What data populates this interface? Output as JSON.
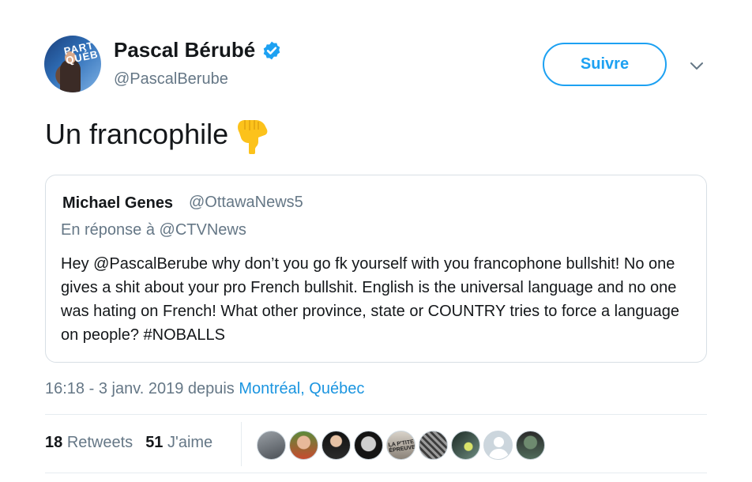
{
  "author": {
    "name": "Pascal Bérubé",
    "handle": "@PascalBerube",
    "avatar_text": "PART\nQUÉB",
    "verified_icon": "verified-badge-icon"
  },
  "follow_label": "Suivre",
  "tweet_text": "Un francophile",
  "emoji": "backhand-index-pointing-down",
  "quoted": {
    "name": "Michael Genes",
    "handle": "@OttawaNews5",
    "reply_to": "En réponse à @CTVNews",
    "body": "Hey @PascalBerube why don’t you go fk yourself with you francophone bullshit! No one gives a shit about your pro French bullshit. English is the universal language and no one was hating on French! What other province, state or COUNTRY tries to force a language on people? #NOBALLS"
  },
  "meta": {
    "time": "16:18 - 3 janv. 2019 depuis ",
    "location": "Montréal, Québec"
  },
  "stats": {
    "retweets_count": "18",
    "retweets_label": "Retweets",
    "likes_count": "51",
    "likes_label": "J'aime"
  },
  "likers_avatar_text": "LA P'TITE ÉPREUVE",
  "colors": {
    "accent": "#1da1f2",
    "link": "#1b95e0",
    "secondary_text": "#657786",
    "primary_text": "#14171a"
  }
}
